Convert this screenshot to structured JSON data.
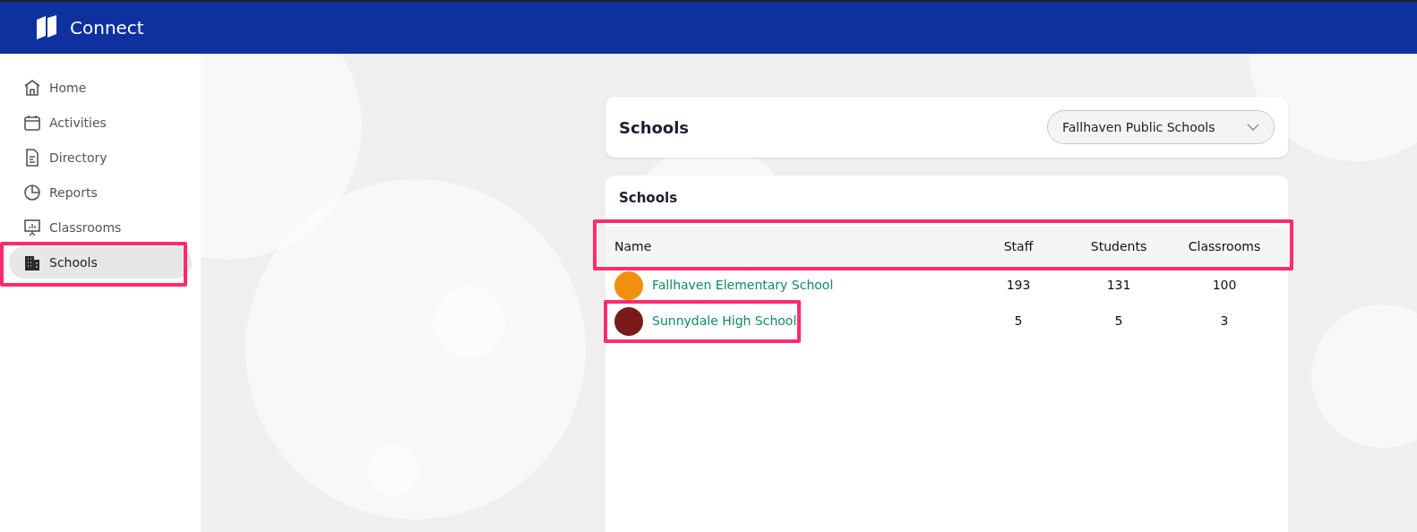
{
  "app": {
    "title": "Connect"
  },
  "sidebar": {
    "items": [
      {
        "kind": "home",
        "label": "Home",
        "selected": false,
        "highlighted": false
      },
      {
        "kind": "calendar",
        "label": "Activities",
        "selected": false,
        "highlighted": false
      },
      {
        "kind": "document",
        "label": "Directory",
        "selected": false,
        "highlighted": false
      },
      {
        "kind": "pie",
        "label": "Reports",
        "selected": false,
        "highlighted": false
      },
      {
        "kind": "board",
        "label": "Classrooms",
        "selected": false,
        "highlighted": false
      },
      {
        "kind": "building",
        "label": "Schools",
        "selected": true,
        "highlighted": true
      }
    ]
  },
  "page_header": {
    "title": "Schools",
    "district_select": {
      "value": "Fallhaven Public Schools"
    }
  },
  "table": {
    "title": "Schools",
    "header_highlighted": true,
    "columns": [
      "Name",
      "Staff",
      "Students",
      "Classrooms"
    ],
    "rows": [
      {
        "color": "#f0900f",
        "name": "Fallhaven Elementary School",
        "staff": "193",
        "students": "131",
        "classrooms": "100",
        "highlighted": false
      },
      {
        "color": "#7a1a1a",
        "name": "Sunnydale High School",
        "staff": "5",
        "students": "5",
        "classrooms": "3",
        "highlighted": true
      }
    ]
  }
}
